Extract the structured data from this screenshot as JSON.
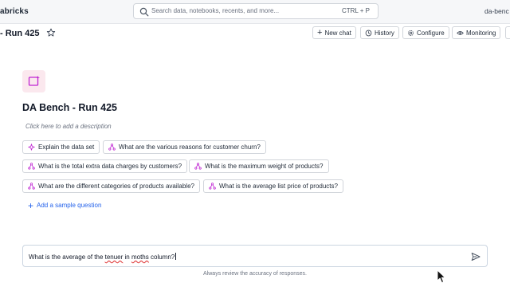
{
  "topbar": {
    "brand": "abricks",
    "search_placeholder": "Search data, notebooks, recents, and more...",
    "search_shortcut": "CTRL + P",
    "workspace": "da-benc"
  },
  "header": {
    "title": "- Run 425",
    "buttons": {
      "new_chat": "New chat",
      "history": "History",
      "configure": "Configure",
      "monitoring": "Monitoring"
    }
  },
  "space": {
    "title": "DA Bench - Run 425",
    "description_placeholder": "Click here to add a description"
  },
  "suggestions": [
    "Explain the data set",
    "What are the various reasons for customer churn?",
    "What is the total extra data charges by customers?",
    "What is the maximum weight of products?",
    "What are the different categories of products available?",
    "What is the average list price of products?"
  ],
  "add_sample": "Add a sample question",
  "chat": {
    "text_parts": [
      "What is the average of the ",
      "tenuer",
      " in ",
      "moths",
      " column?"
    ]
  },
  "footnote": "Always review the accuracy of responses.",
  "colors": {
    "link": "#2563eb",
    "accent_icon": "#c026d3",
    "icon_bg": "#fbe8ee"
  },
  "icons": {
    "search": "search-icon",
    "star": "star-icon",
    "history": "history-icon",
    "configure": "gear-icon",
    "monitoring": "eye-icon",
    "sparkle": "sparkle-icon",
    "sample": "data-flow-icon",
    "send": "send-icon"
  }
}
